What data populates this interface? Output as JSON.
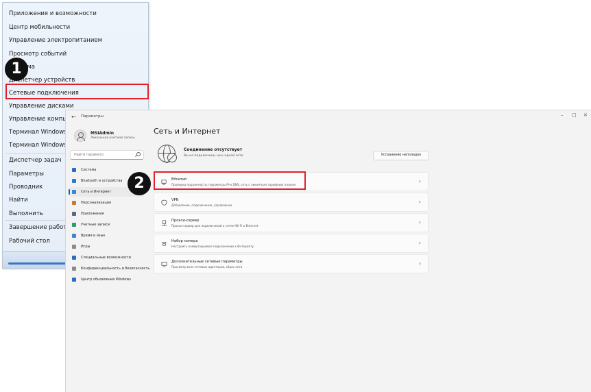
{
  "context_menu": {
    "items": [
      "Приложения и возможности",
      "Центр мобильности",
      "Управление электропитанием",
      "Просмотр событий",
      "Система",
      "Диспетчер устройств",
      "Сетевые подключения",
      "Управление дисками",
      "Управление компьютером",
      "Терминал Windows",
      "Терминал Windows (Администратор)",
      "Диспетчер задач",
      "Параметры",
      "Проводник",
      "Найти",
      "Выполнить",
      "Завершение работы или выход из системы",
      "Рабочий стол"
    ],
    "highlighted": "Сетевые подключения"
  },
  "badges": {
    "one": "1",
    "two": "2"
  },
  "settings": {
    "window_title": "Параметры",
    "back_glyph": "←",
    "controls": {
      "minimize": "–",
      "maximize": "□",
      "close": "✕"
    },
    "user": {
      "name": "MSIAdmin",
      "account": "Локальная учетная запись"
    },
    "search_placeholder": "Найти параметр",
    "nav": [
      {
        "label": "Система",
        "color": "#2a6cc4"
      },
      {
        "label": "Bluetooth и устройства",
        "color": "#2b7bd6"
      },
      {
        "label": "Сеть и Интернет",
        "color": "#3a86d8"
      },
      {
        "label": "Персонализация",
        "color": "#c77b2e"
      },
      {
        "label": "Приложения",
        "color": "#5a6a86"
      },
      {
        "label": "Учетные записи",
        "color": "#2f9e6b"
      },
      {
        "label": "Время и язык",
        "color": "#3a86d8"
      },
      {
        "label": "Игры",
        "color": "#8a8a8a"
      },
      {
        "label": "Специальные возможности",
        "color": "#2a6cc4"
      },
      {
        "label": "Конфиденциальность и безопасность",
        "color": "#8a8a8a"
      },
      {
        "label": "Центр обновления Windows",
        "color": "#2a6cc4"
      }
    ],
    "active_nav": "Сеть и Интернет",
    "page_title": "Сеть и Интернет",
    "status": {
      "title": "Соединение отсутствует",
      "subtitle": "Вы не подключены ни к одной сети",
      "button": "Устранение неполадок"
    },
    "cards": [
      {
        "title": "Ethernet",
        "subtitle": "Проверка подлинности, параметры IP-и DNS, сеть с лимитным тарифным планом",
        "icon": "ethernet-icon"
      },
      {
        "title": "VPN",
        "subtitle": "Добавление, подключение, управление",
        "icon": "vpn-shield-icon"
      },
      {
        "title": "Прокси-сервер",
        "subtitle": "Прокси-сервер для подключений к сетям Wi-Fi и Ethernet",
        "icon": "proxy-icon"
      },
      {
        "title": "Набор номера",
        "subtitle": "Настроить коммутируемое подключение к Интернету",
        "icon": "dialup-icon"
      },
      {
        "title": "Дополнительные сетевые параметры",
        "subtitle": "Просмотр всех сетевых адаптеров, сброс сети",
        "icon": "monitor-icon"
      }
    ],
    "chevron": "›"
  }
}
